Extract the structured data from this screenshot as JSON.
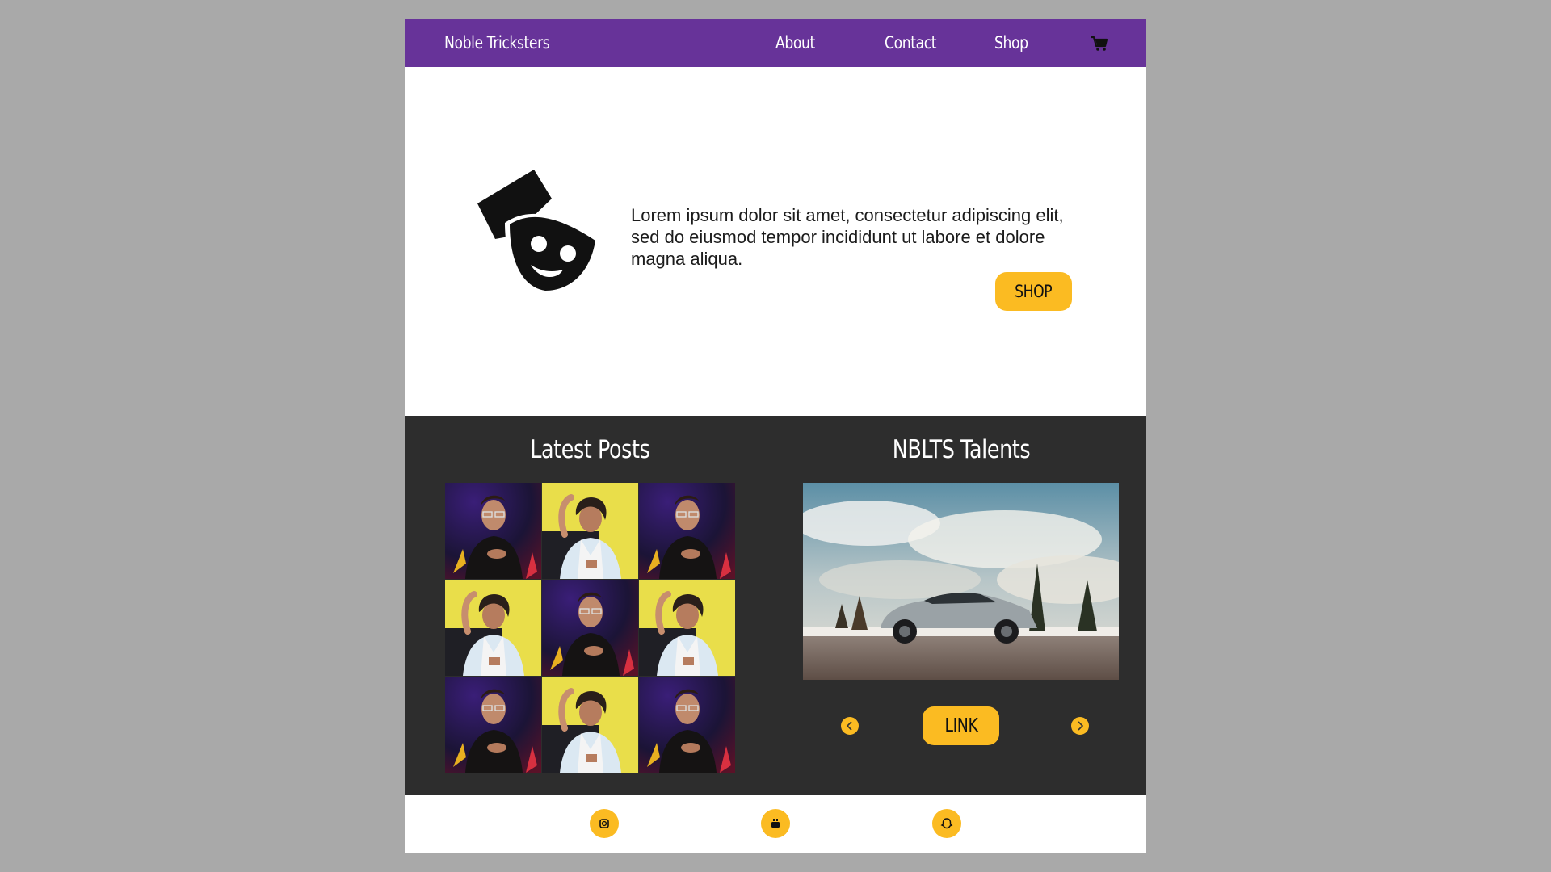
{
  "colors": {
    "background": "#a9a9a9",
    "nav": "#673399",
    "accent": "#fbbb22",
    "dark_panel": "#2d2d2d",
    "white": "#ffffff"
  },
  "nav": {
    "brand": "Noble Tricksters",
    "links": [
      {
        "label": "About"
      },
      {
        "label": "Contact"
      },
      {
        "label": "Shop"
      }
    ],
    "cart_icon": "shopping-cart-icon"
  },
  "hero": {
    "logo_icon": "theater-mask-icon",
    "text": "Lorem ipsum dolor sit amet, consectetur adipiscing elit, sed do eiusmod tempor incididunt ut labore et dolore magna aliqua.",
    "shop_button": "SHOP"
  },
  "latest_posts": {
    "title": "Latest Posts"
  },
  "talents": {
    "title": "NBLTS Talents",
    "link_button": "LINK",
    "prev_icon": "chevron-left-icon",
    "next_icon": "chevron-right-icon"
  },
  "footer": {
    "social_icons": [
      "instagram-icon",
      "youtube-icon",
      "snapchat-icon"
    ]
  }
}
